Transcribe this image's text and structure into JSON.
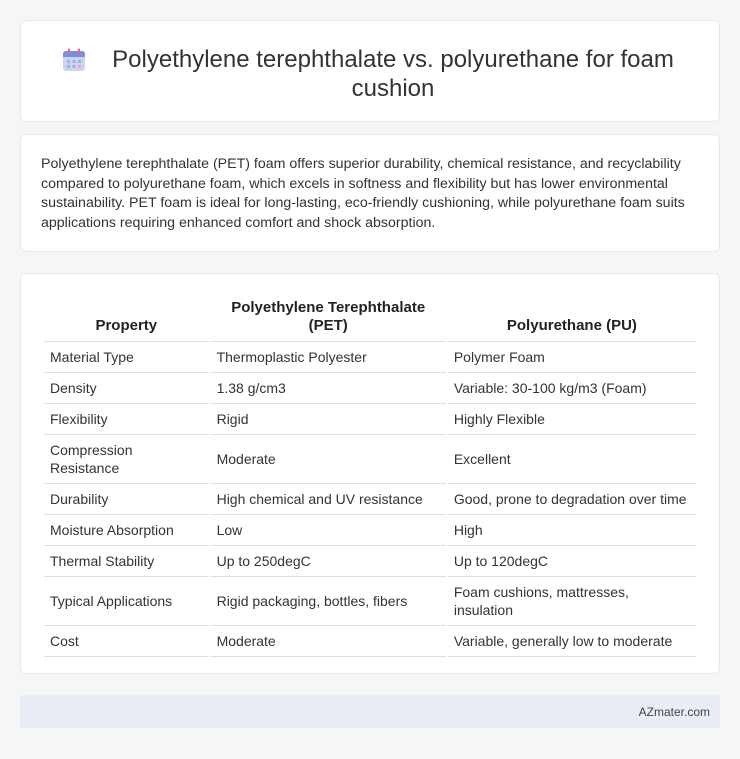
{
  "header": {
    "icon": "calendar-icon",
    "title": "Polyethylene terephthalate vs. polyurethane for foam cushion"
  },
  "summary": {
    "text": "Polyethylene terephthalate (PET) foam offers superior durability, chemical resistance, and recyclability compared to polyurethane foam, which excels in softness and flexibility but has lower environmental sustainability. PET foam is ideal for long-lasting, eco-friendly cushioning, while polyurethane foam suits applications requiring enhanced comfort and shock absorption."
  },
  "table": {
    "headers": [
      "Property",
      "Polyethylene Terephthalate (PET)",
      "Polyurethane (PU)"
    ],
    "rows": [
      [
        "Material Type",
        "Thermoplastic Polyester",
        "Polymer Foam"
      ],
      [
        "Density",
        "1.38 g/cm3",
        "Variable: 30-100 kg/m3 (Foam)"
      ],
      [
        "Flexibility",
        "Rigid",
        "Highly Flexible"
      ],
      [
        "Compression Resistance",
        "Moderate",
        "Excellent"
      ],
      [
        "Durability",
        "High chemical and UV resistance",
        "Good, prone to degradation over time"
      ],
      [
        "Moisture Absorption",
        "Low",
        "High"
      ],
      [
        "Thermal Stability",
        "Up to 250degC",
        "Up to 120degC"
      ],
      [
        "Typical Applications",
        "Rigid packaging, bottles, fibers",
        "Foam cushions, mattresses, insulation"
      ],
      [
        "Cost",
        "Moderate",
        "Variable, generally low to moderate"
      ]
    ]
  },
  "footer": {
    "site": "AZmater.com"
  }
}
